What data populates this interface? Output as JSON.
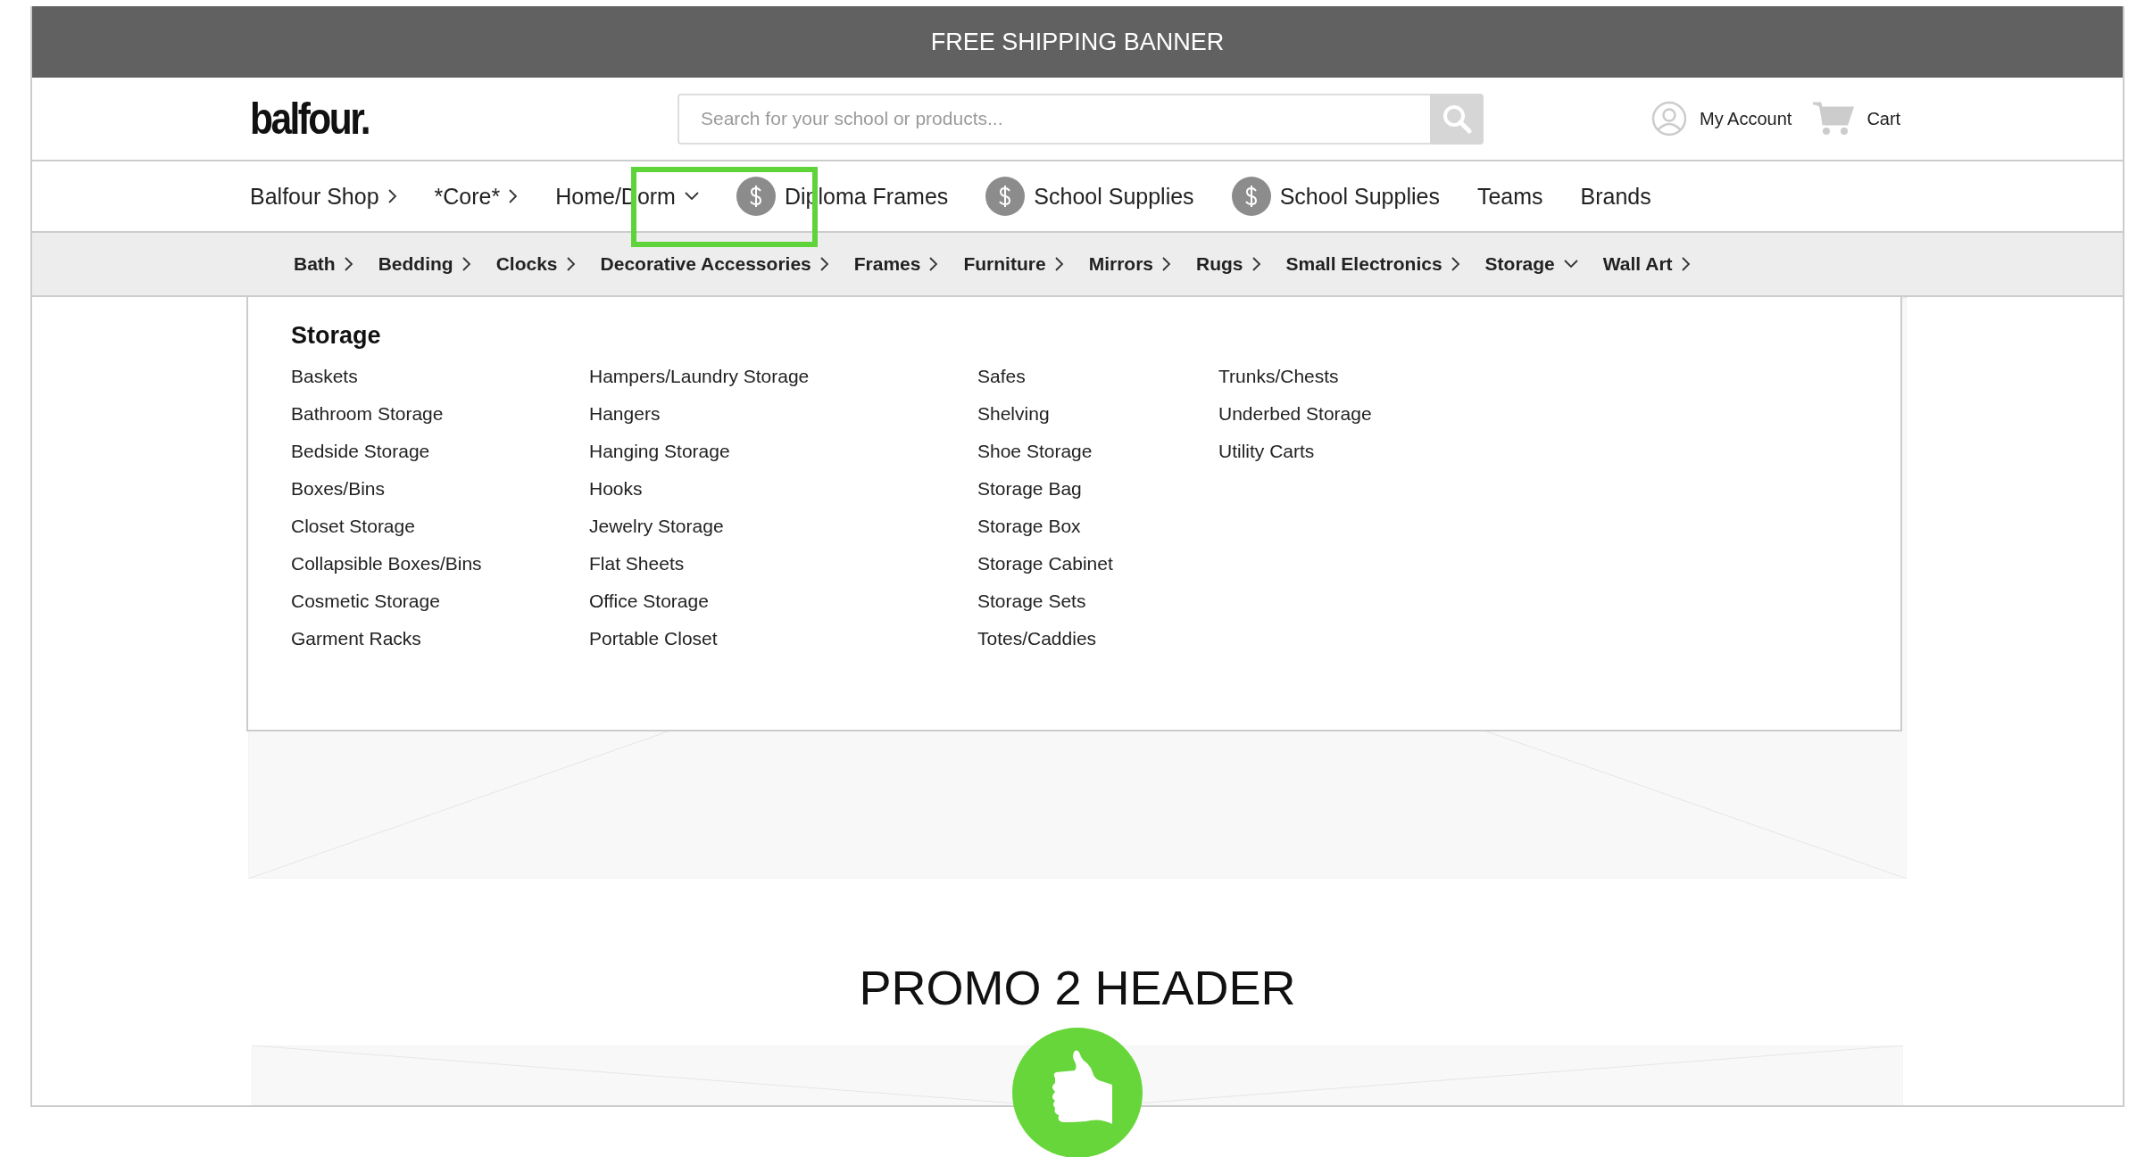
{
  "banner": {
    "text": "FREE SHIPPING BANNER"
  },
  "header": {
    "logo": "balfour.",
    "search": {
      "placeholder": "Search for your school or products..."
    },
    "account_link": "My Account",
    "cart_link": "Cart"
  },
  "main_nav": [
    {
      "label": "Balfour Shop",
      "kind": "category",
      "expanded": false
    },
    {
      "label": "*Core*",
      "kind": "category",
      "expanded": false
    },
    {
      "label": "Home/Dorm",
      "kind": "category",
      "expanded": true
    },
    {
      "label": "Diploma Frames",
      "kind": "promo"
    },
    {
      "label": "School Supplies",
      "kind": "promo"
    },
    {
      "label": "School Supplies",
      "kind": "promo"
    },
    {
      "label": "Teams",
      "kind": "link"
    },
    {
      "label": "Brands",
      "kind": "link"
    }
  ],
  "sub_nav": [
    {
      "label": "Bath",
      "expanded": false
    },
    {
      "label": "Bedding",
      "expanded": false
    },
    {
      "label": "Clocks",
      "expanded": false
    },
    {
      "label": "Decorative Accessories",
      "expanded": false
    },
    {
      "label": "Frames",
      "expanded": false
    },
    {
      "label": "Furniture",
      "expanded": false
    },
    {
      "label": "Mirrors",
      "expanded": false
    },
    {
      "label": "Rugs",
      "expanded": false
    },
    {
      "label": "Small Electronics",
      "expanded": false
    },
    {
      "label": "Storage",
      "expanded": true
    },
    {
      "label": "Wall Art",
      "expanded": false
    }
  ],
  "dropdown": {
    "title": "Storage",
    "columns": [
      [
        "Baskets",
        "Bathroom Storage",
        "Bedside Storage",
        "Boxes/Bins",
        "Closet Storage",
        "Collapsible Boxes/Bins",
        "Cosmetic Storage",
        "Garment Racks"
      ],
      [
        "Hampers/Laundry Storage",
        "Hangers",
        "Hanging Storage",
        "Hooks",
        "Jewelry Storage",
        "Flat Sheets",
        "Office Storage",
        "Portable Closet"
      ],
      [
        "Safes",
        "Shelving",
        "Shoe Storage",
        "Storage Bag",
        "Storage Box",
        "Storage Cabinet",
        "Storage Sets",
        "Totes/Caddies"
      ],
      [
        "Trunks/Chests",
        "Underbed Storage",
        "Utility Carts"
      ]
    ]
  },
  "promo_header": "PROMO 2 HEADER"
}
